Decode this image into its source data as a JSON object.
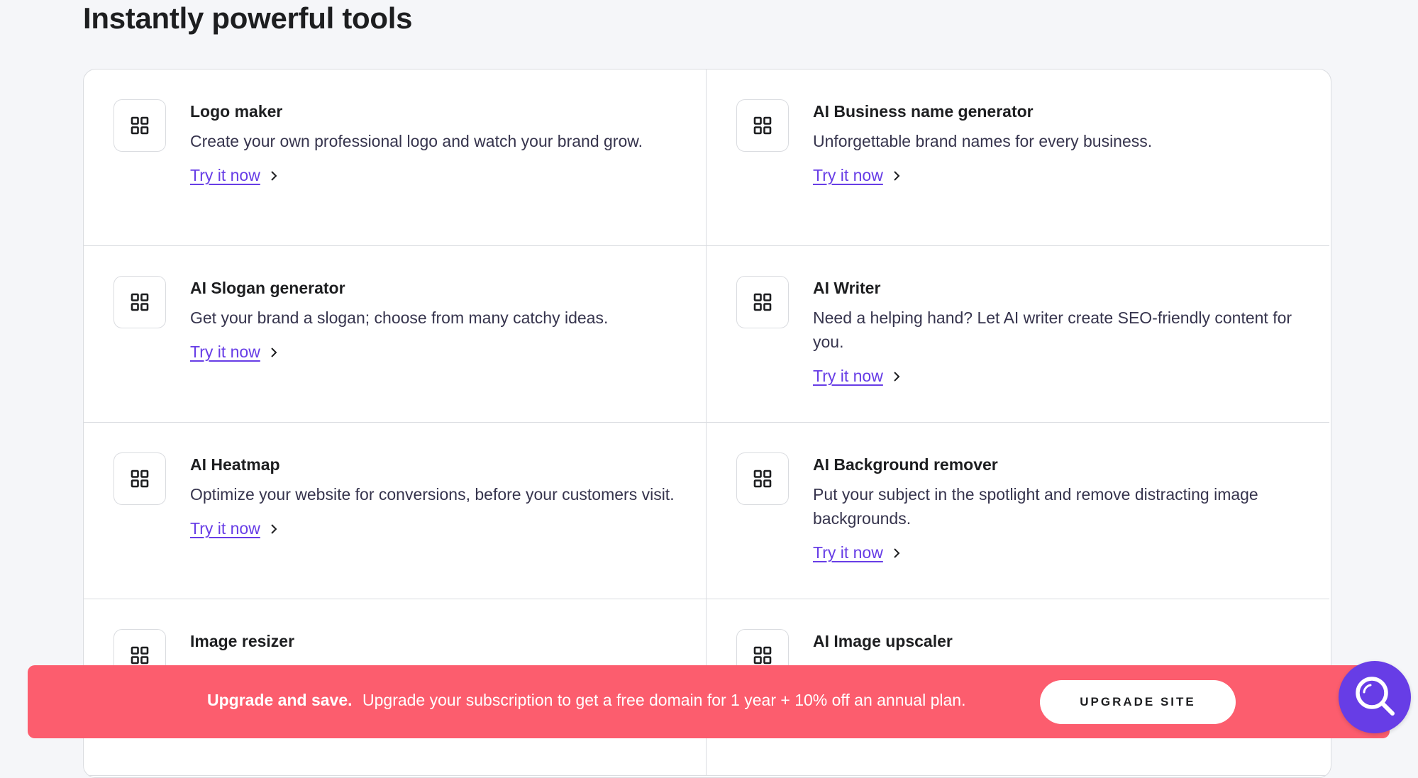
{
  "page": {
    "title": "Instantly powerful tools"
  },
  "tools": [
    {
      "name": "Logo maker",
      "description": "Create your own professional logo and watch your brand grow.",
      "link": "Try it now"
    },
    {
      "name": "AI Business name generator",
      "description": "Unforgettable brand names for every business.",
      "link": "Try it now"
    },
    {
      "name": "AI Slogan generator",
      "description": "Get your brand a slogan; choose from many catchy ideas.",
      "link": "Try it now"
    },
    {
      "name": "AI Writer",
      "description": "Need a helping hand? Let AI writer create SEO-friendly content for you.",
      "link": "Try it now"
    },
    {
      "name": "AI Heatmap",
      "description": "Optimize your website for conversions, before your customers visit.",
      "link": "Try it now"
    },
    {
      "name": "AI Background remover",
      "description": "Put your subject in the spotlight and remove distracting image backgrounds.",
      "link": "Try it now"
    },
    {
      "name": "Image resizer",
      "description": "",
      "link": ""
    },
    {
      "name": "AI Image upscaler",
      "description": "",
      "link": ""
    }
  ],
  "banner": {
    "strong": "Upgrade and save.",
    "message": "Upgrade your subscription to get a free domain for 1 year + 10% off an annual plan.",
    "button_label": "UPGRADE SITE"
  },
  "colors": {
    "accent": "#673de6",
    "banner": "#fc5d6e",
    "border": "#dadce0",
    "background": "#f5f6f9"
  },
  "icons": {
    "tool": "grid-icon",
    "link": "chevron-right-icon",
    "fab": "search-icon"
  }
}
